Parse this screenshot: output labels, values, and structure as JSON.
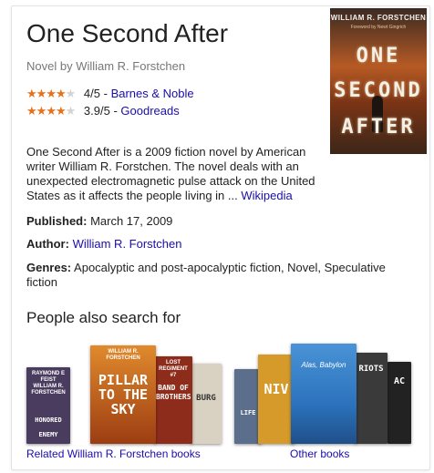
{
  "panel": {
    "title": "One Second After",
    "subtitle": "Novel by William R. Forstchen",
    "ratings": [
      {
        "score": "4/5",
        "stars_filled": 4,
        "separator": "-",
        "source": "Barnes & Noble"
      },
      {
        "score": "3.9/5",
        "stars_filled": 4,
        "separator": "-",
        "source": "Goodreads"
      }
    ],
    "cover": {
      "author": "WILLIAM R. FORSTCHEN",
      "tagline": "Foreword by Newt Gingrich",
      "title_line_1": "ONE",
      "title_line_2": "SECOND",
      "title_line_3": "AFTER"
    },
    "description": {
      "text": "One Second After is a 2009 fiction novel by American writer William R. Forstchen. The novel deals with an unexpected electromagnetic pulse attack on the United States as it affects the people living in ...",
      "source_link": "Wikipedia"
    },
    "facts": {
      "published_label": "Published:",
      "published_value": "March 17, 2009",
      "author_label": "Author:",
      "author_value": "William R. Forstchen",
      "genres_label": "Genres:",
      "genres_value": "Apocalyptic and post-apocalyptic fiction, Novel, Speculative fiction"
    },
    "also_search": {
      "heading": "People also search for",
      "groups": [
        {
          "caption": "Related William R. Forstchen books",
          "books": [
            {
              "title_small": "RAYMOND E FEIST WILLIAM R. FORSTCHEN",
              "title_big": "HONORED ENEMY",
              "color": "#4a3c5e"
            },
            {
              "title_small": "WILLIAM R. FORSTCHEN",
              "title_big": "PILLAR TO THE SKY",
              "color": "#c76a1e"
            },
            {
              "title_small": "LOST REGIMENT #7",
              "title_big": "BAND OF BROTHERS",
              "color": "#8e2c1c"
            },
            {
              "title_small": "",
              "title_big": "BURG",
              "color": "#d9d2c2"
            }
          ]
        },
        {
          "caption": "Other books",
          "books": [
            {
              "title_small": "",
              "title_big": "LIFE",
              "color": "#5b6f8c"
            },
            {
              "title_small": "",
              "title_big": "NIV",
              "color": "#d69a2a"
            },
            {
              "title_small": "Alas, Babylon",
              "title_big": "",
              "color": "#2c73bd"
            },
            {
              "title_small": "",
              "title_big": "RIOTS",
              "color": "#3a3a3a"
            },
            {
              "title_small": "",
              "title_big": "AC",
              "color": "#222222"
            }
          ]
        }
      ]
    }
  }
}
